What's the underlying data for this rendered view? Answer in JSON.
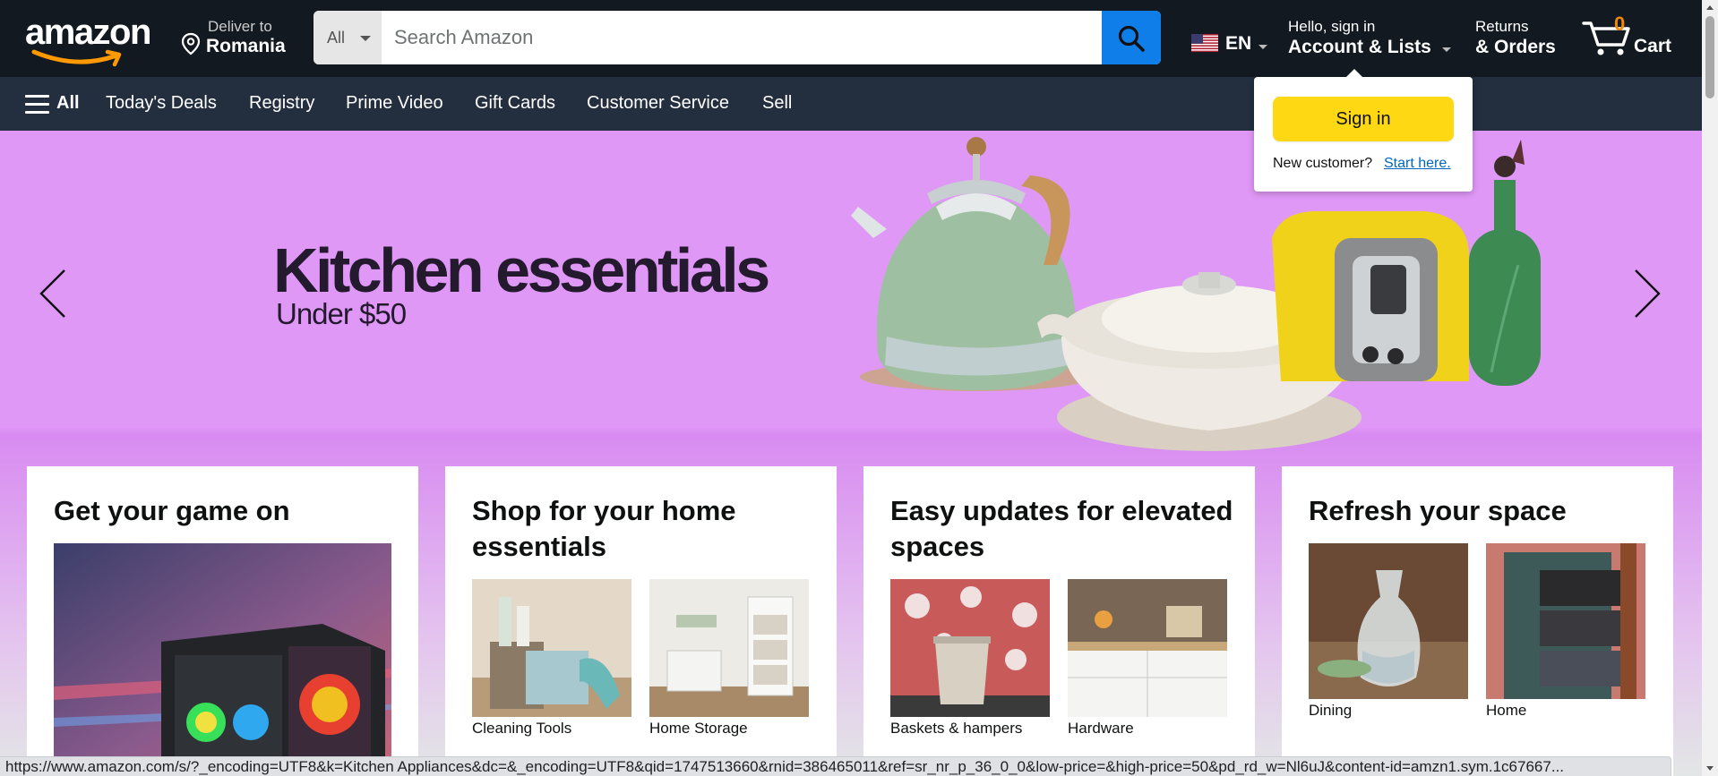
{
  "header": {
    "logo_text": "amazon",
    "deliver_line1": "Deliver to",
    "deliver_line2": "Romania",
    "search_category": "All",
    "search_placeholder": "Search Amazon",
    "lang_code": "EN",
    "account_line1": "Hello, sign in",
    "account_line2": "Account & Lists",
    "returns_line1": "Returns",
    "returns_line2": "& Orders",
    "cart_count": "0",
    "cart_label": "Cart"
  },
  "subnav": {
    "all_label": "All",
    "items": [
      "Today's Deals",
      "Registry",
      "Prime Video",
      "Gift Cards",
      "Customer Service",
      "Sell"
    ]
  },
  "hero": {
    "title": "Kitchen essentials",
    "subtitle": "Under $50"
  },
  "cards": [
    {
      "title": "Get your game on",
      "tiles": []
    },
    {
      "title": "Shop for your home essentials",
      "tiles": [
        "Cleaning Tools",
        "Home Storage"
      ]
    },
    {
      "title": "Easy updates for elevated spaces",
      "tiles": [
        "Baskets & hampers",
        "Hardware"
      ]
    },
    {
      "title": "Refresh your space",
      "tiles": [
        "Dining",
        "Home"
      ]
    }
  ],
  "popover": {
    "signin_label": "Sign in",
    "new_customer": "New customer?",
    "start_here": "Start here."
  },
  "status_url": "https://www.amazon.com/s/?_encoding=UTF8&k=Kitchen Appliances&dc=&_encoding=UTF8&qid=1747513660&rnid=386465011&ref=sr_nr_p_36_0_0&low-price=&high-price=50&pd_rd_w=Nl6uJ&content-id=amzn1.sym.1c67667...",
  "colors": {
    "nav_dark": "#131921",
    "subnav": "#232f3e",
    "search_button": "#0f7ee8",
    "signin_button": "#ffd814",
    "hero_bg": "#e098f7",
    "cart_count": "#f08804",
    "link": "#0066c0"
  },
  "icons": [
    "location-pin-icon",
    "search-icon",
    "us-flag-icon",
    "cart-icon",
    "hamburger-icon",
    "chevron-left-icon",
    "chevron-right-icon"
  ]
}
